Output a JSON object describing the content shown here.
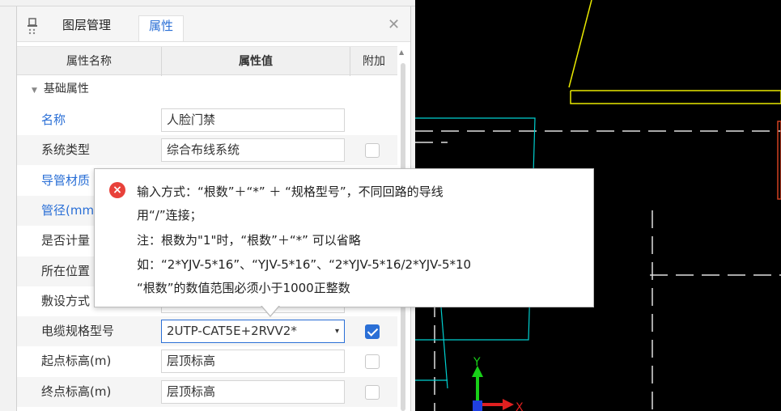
{
  "tabs": {
    "layers": "图层管理",
    "properties": "属性"
  },
  "table_header": {
    "name": "属性名称",
    "value": "属性值",
    "extra": "附加"
  },
  "group": {
    "label": "基础属性"
  },
  "rows": [
    {
      "label": "名称",
      "value": "人脸门禁",
      "checkbox": "none",
      "label_color": "blue"
    },
    {
      "label": "系统类型",
      "value": "综合布线系统",
      "checkbox": "unchecked",
      "label_color": "black"
    },
    {
      "label": "导管材质",
      "value": "",
      "checkbox": "none",
      "label_color": "blue"
    },
    {
      "label": "管径(mm)",
      "value": "",
      "checkbox": "none",
      "label_color": "blue"
    },
    {
      "label": "是否计量",
      "value": "",
      "checkbox": "none",
      "label_color": "black"
    },
    {
      "label": "所在位置",
      "value": "",
      "checkbox": "none",
      "label_color": "black"
    },
    {
      "label": "敷设方式",
      "value": "",
      "checkbox": "none",
      "label_color": "black"
    },
    {
      "label": "电缆规格型号",
      "value": "2UTP-CAT5E+2RVV2*",
      "checkbox": "checked",
      "label_color": "black"
    },
    {
      "label": "起点标高(m)",
      "value": "层顶标高",
      "checkbox": "unchecked",
      "label_color": "black"
    },
    {
      "label": "终点标高(m)",
      "value": "层顶标高",
      "checkbox": "unchecked",
      "label_color": "black"
    }
  ],
  "tooltip": {
    "line1": "输入方式：“根数”＋“*” ＋ “规格型号”，不同回路的导线",
    "line2": "用“/”连接；",
    "line3": "注：根数为\"1\"时，“根数”＋“*” 可以省略",
    "line4": "如：“2*YJV-5*16”、“YJV-5*16”、“2*YJV-5*16/2*YJV-5*10",
    "line5": "“根数”的数值范围必须小于1000正整数"
  },
  "axis": {
    "x": "X",
    "y": "Y"
  },
  "colors": {
    "accent": "#2a6fd6",
    "error": "#e8413a",
    "cad_yellow": "#e8e800",
    "cad_cyan": "#00d0d0",
    "cad_white": "#e0e0e0"
  }
}
